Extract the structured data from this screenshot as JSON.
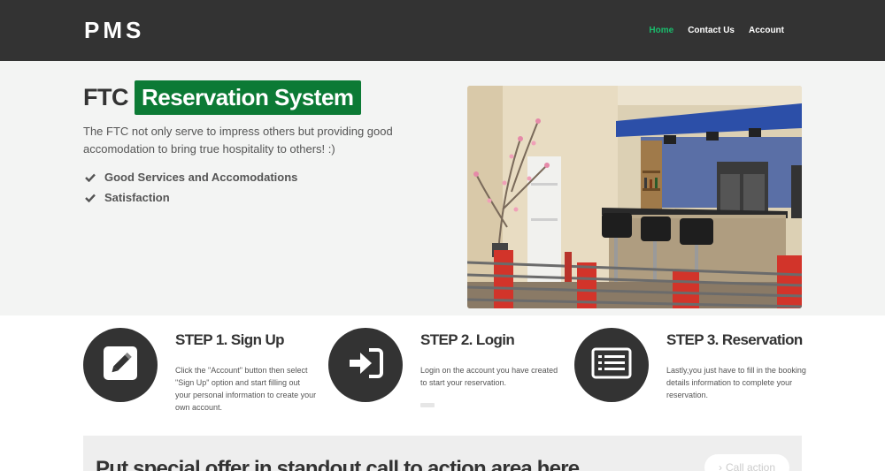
{
  "header": {
    "brand": "PMS",
    "nav": [
      {
        "label": "Home",
        "active": true
      },
      {
        "label": "Contact Us",
        "active": false
      },
      {
        "label": "Account",
        "active": false
      }
    ]
  },
  "hero": {
    "title_plain": "FTC",
    "title_highlight": "Reservation System",
    "description": "The FTC not only serve to impress others but providing good accomodation to bring true hospitality to others! :)",
    "features": [
      {
        "icon": "check-icon",
        "label": "Good Services and Accomodations"
      },
      {
        "icon": "check-icon",
        "label": "Satisfaction"
      }
    ]
  },
  "steps": [
    {
      "icon": "pencil-icon",
      "title": "STEP 1. Sign Up",
      "text": "Click the \"Account\" button then select \"Sign Up\" option and start filling out your personal information to create your own account."
    },
    {
      "icon": "sign-in-icon",
      "title": "STEP 2. Login",
      "text": "Login on the account you have created to start your reservation."
    },
    {
      "icon": "list-icon",
      "title": "STEP 3. Reservation",
      "text": "Lastly,you just have to fill in the booking details information to complete your reservation."
    }
  ],
  "cta": {
    "text": "Put special offer in standout call to action area here",
    "button_label": "Call action"
  },
  "colors": {
    "navbar": "#333333",
    "accent_green": "#1abc6c",
    "highlight_green": "#0c7a35",
    "hero_bg": "#f3f4f3"
  }
}
